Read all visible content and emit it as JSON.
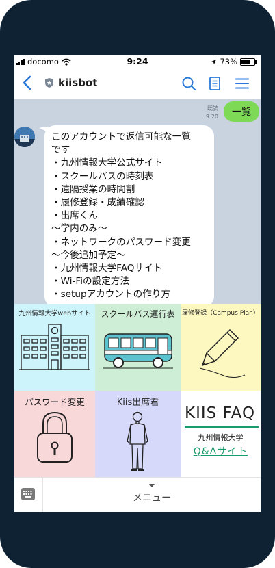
{
  "status_bar": {
    "carrier": "docomo",
    "time": "9:24",
    "battery_text": "73%",
    "battery_level": 0.73
  },
  "header": {
    "title": "kiisbot",
    "back_icon": "chevron-left-icon",
    "search_icon": "search-icon",
    "notes_icon": "notes-icon",
    "menu_icon": "hamburger-icon",
    "accent": "#2a7ad9"
  },
  "chat": {
    "sent_message": {
      "text": "一覧",
      "read": "既読",
      "time": "9:20"
    },
    "bot_message": {
      "lines": [
        "このアカウントで返信可能な一覧",
        "です",
        "・九州情報大学公式サイト",
        "・スクールバスの時刻表",
        "・遠隔授業の時間割",
        "・履修登録・成績確認",
        "・出席くん",
        "〜学内のみ〜",
        "・ネットワークのパスワード変更",
        "〜今後追加予定〜",
        "・九州情報大学FAQサイト",
        "・Wi-Fiの設定方法",
        "・setupアカウントの作り方"
      ]
    }
  },
  "rich_menu": {
    "tiles": [
      {
        "label": "九州情報大学webサイト",
        "icon": "school-building-icon",
        "color": "#cdf3fb"
      },
      {
        "label": "スクールバス運行表",
        "icon": "bus-icon",
        "color": "#cfeed6"
      },
      {
        "label": "履修登録（Campus Plan）",
        "icon": "pencil-icon",
        "color": "#fdf8c0"
      },
      {
        "label": "パスワード変更",
        "icon": "padlock-icon",
        "color": "#f9d8da"
      },
      {
        "label": "Kiis出席君",
        "icon": "student-figure-icon",
        "color": "#d7d9fb"
      },
      {
        "title": "KIIS FAQ",
        "sub": "九州情報大学",
        "link": "Q&Aサイト",
        "color": "#ffffff",
        "accent": "#1a9b6c"
      }
    ]
  },
  "bottom_bar": {
    "keyboard_icon": "keyboard-icon",
    "menu_label": "メニュー"
  }
}
